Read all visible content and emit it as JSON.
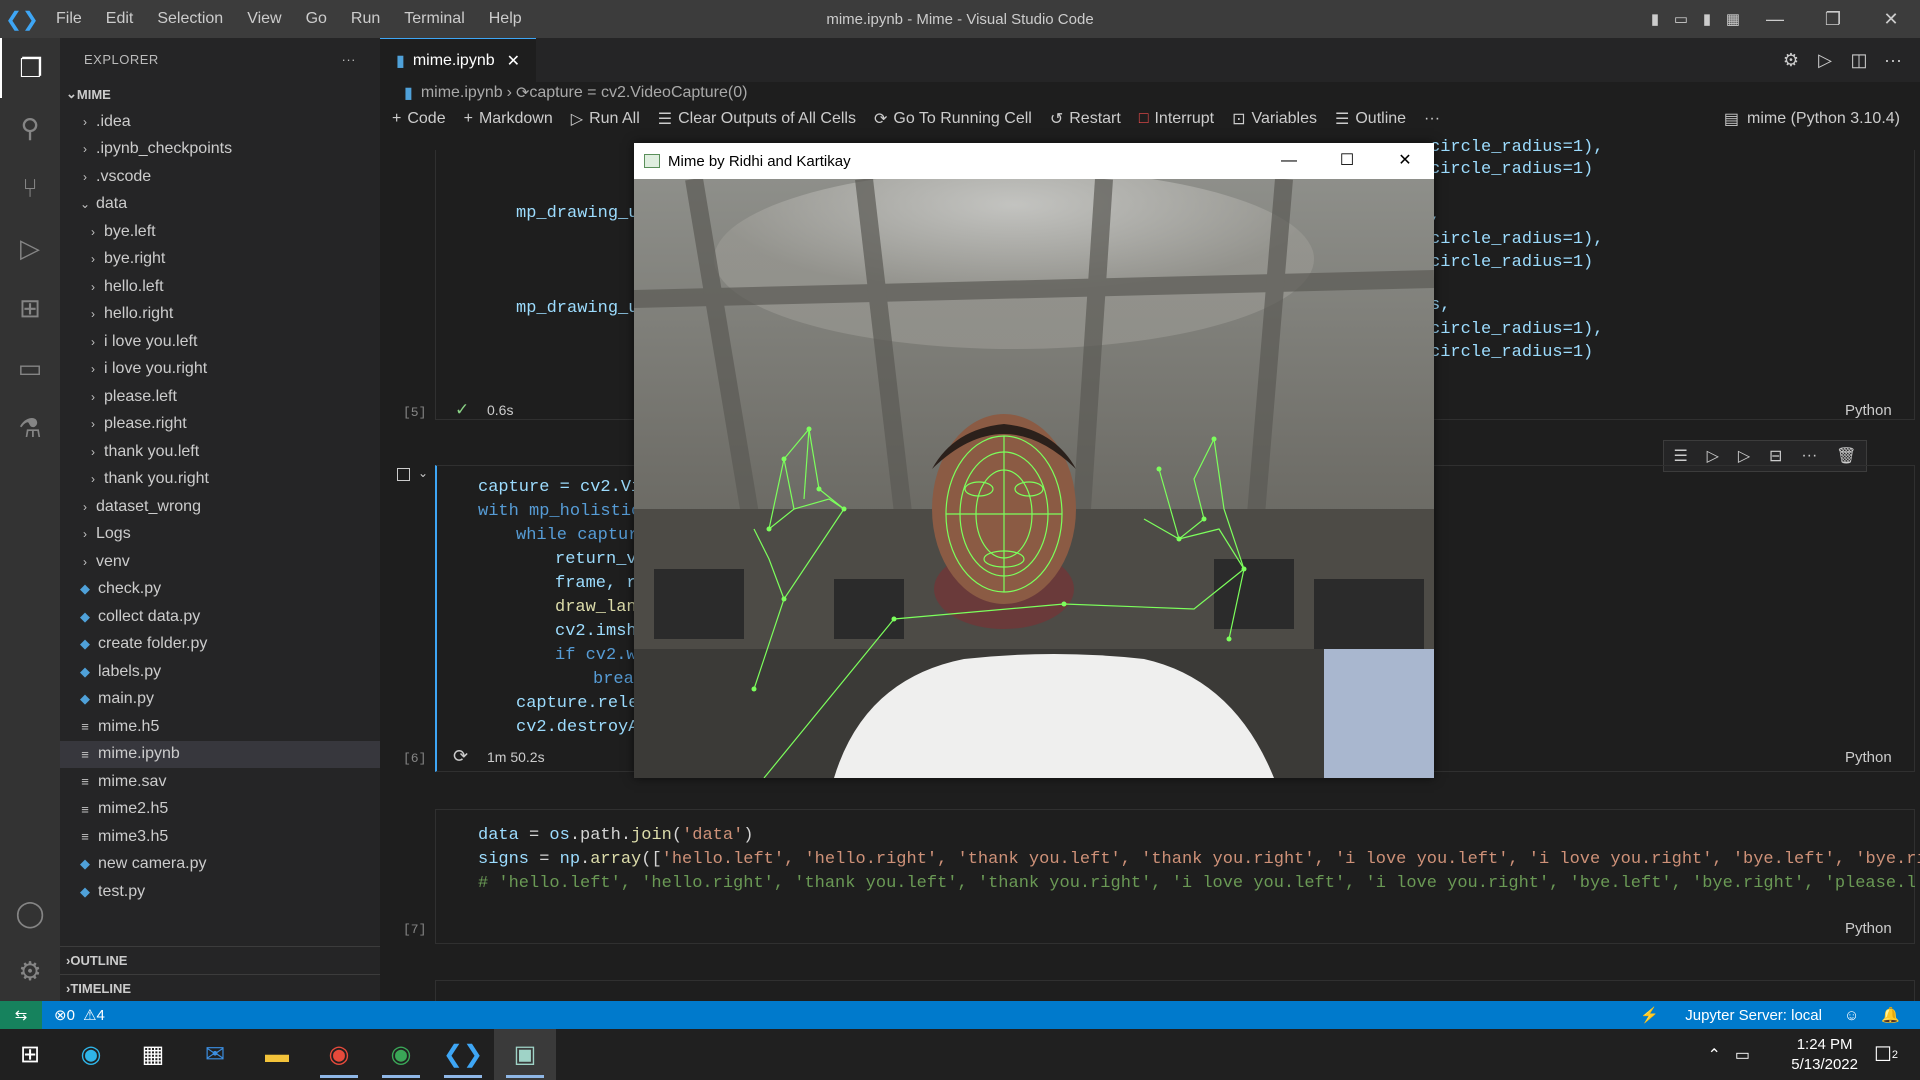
{
  "window": {
    "title": "mime.ipynb - Mime - Visual Studio Code",
    "menu": [
      "File",
      "Edit",
      "Selection",
      "View",
      "Go",
      "Run",
      "Terminal",
      "Help"
    ]
  },
  "explorer": {
    "header": "EXPLORER",
    "more": "···",
    "root": "MIME",
    "items": [
      {
        "label": ".idea",
        "kind": "folder",
        "indent": 1,
        "expanded": false
      },
      {
        "label": ".ipynb_checkpoints",
        "kind": "folder",
        "indent": 1,
        "expanded": false
      },
      {
        "label": ".vscode",
        "kind": "folder",
        "indent": 1,
        "expanded": false
      },
      {
        "label": "data",
        "kind": "folder",
        "indent": 1,
        "expanded": true
      },
      {
        "label": "bye.left",
        "kind": "folder",
        "indent": 2,
        "expanded": false
      },
      {
        "label": "bye.right",
        "kind": "folder",
        "indent": 2,
        "expanded": false
      },
      {
        "label": "hello.left",
        "kind": "folder",
        "indent": 2,
        "expanded": false
      },
      {
        "label": "hello.right",
        "kind": "folder",
        "indent": 2,
        "expanded": false
      },
      {
        "label": "i love you.left",
        "kind": "folder",
        "indent": 2,
        "expanded": false
      },
      {
        "label": "i love you.right",
        "kind": "folder",
        "indent": 2,
        "expanded": false
      },
      {
        "label": "please.left",
        "kind": "folder",
        "indent": 2,
        "expanded": false
      },
      {
        "label": "please.right",
        "kind": "folder",
        "indent": 2,
        "expanded": false
      },
      {
        "label": "thank you.left",
        "kind": "folder",
        "indent": 2,
        "expanded": false
      },
      {
        "label": "thank you.right",
        "kind": "folder",
        "indent": 2,
        "expanded": false
      },
      {
        "label": "dataset_wrong",
        "kind": "folder",
        "indent": 1,
        "expanded": false
      },
      {
        "label": "Logs",
        "kind": "folder",
        "indent": 1,
        "expanded": false
      },
      {
        "label": "venv",
        "kind": "folder",
        "indent": 1,
        "expanded": false
      },
      {
        "label": "check.py",
        "kind": "py",
        "indent": 1
      },
      {
        "label": "collect data.py",
        "kind": "py",
        "indent": 1
      },
      {
        "label": "create folder.py",
        "kind": "py",
        "indent": 1
      },
      {
        "label": "labels.py",
        "kind": "py",
        "indent": 1
      },
      {
        "label": "main.py",
        "kind": "py",
        "indent": 1
      },
      {
        "label": "mime.h5",
        "kind": "lines",
        "indent": 1
      },
      {
        "label": "mime.ipynb",
        "kind": "lines",
        "indent": 1,
        "selected": true
      },
      {
        "label": "mime.sav",
        "kind": "lines",
        "indent": 1
      },
      {
        "label": "mime2.h5",
        "kind": "lines",
        "indent": 1
      },
      {
        "label": "mime3.h5",
        "kind": "lines",
        "indent": 1
      },
      {
        "label": "new camera.py",
        "kind": "py",
        "indent": 1
      },
      {
        "label": "test.py",
        "kind": "py",
        "indent": 1
      }
    ],
    "outline": "OUTLINE",
    "timeline": "TIMELINE"
  },
  "editor": {
    "tab": "mime.ipynb",
    "breadcrumb_file": "mime.ipynb",
    "breadcrumb_symbol": "capture = cv2.VideoCapture(0)",
    "toolbar": {
      "code": "Code",
      "markdown": "Markdown",
      "run_all": "Run All",
      "clear": "Clear Outputs of All Cells",
      "goto": "Go To Running Cell",
      "restart": "Restart",
      "interrupt": "Interrupt",
      "variables": "Variables",
      "outline": "Outline",
      "more": "···",
      "kernel": "mime (Python 3.10.4)"
    },
    "cell5": {
      "exec": "[5]",
      "time": "0.6s",
      "lang": "Python",
      "left1": "mp_drawing_u",
      "left2": "mp_drawing_u",
      "right": [
        "circle_radius=1),",
        "circle_radius=1)",
        ",",
        "circle_radius=1),",
        "circle_radius=1)",
        "s,",
        "circle_radius=1),",
        "circle_radius=1)"
      ]
    },
    "cell6": {
      "exec": "[6]",
      "time": "1m 50.2s",
      "lang": "Python",
      "lines": [
        "capture = cv2.Vi",
        "with mp_holistic",
        "while captur",
        "return_v",
        "frame, r",
        "draw_lan",
        "cv2.imsh",
        "if cv2.w",
        "brea",
        "capture.rele",
        "cv2.destroyA"
      ]
    },
    "cell7": {
      "exec": "[7]",
      "lang": "Python",
      "line1_var": "data",
      "line1_rest_a": " = ",
      "line1_mod": "os",
      "line1_path": ".path.",
      "line1_fn": "join",
      "line1_arg": "'data'",
      "line2_var": "signs",
      "line2_mod": "np",
      "line2_fn": "array",
      "line2_items": "'hello.left', 'hello.right', 'thank you.left', 'thank you.right', 'i love you.left', 'i love you.right', 'bye.left', 'bye.right',",
      "line3": "# 'hello.left', 'hello.right', 'thank you.left', 'thank you.right', 'i love you.left', 'i love you.right', 'bye.left', 'bye.right', 'please.left', '"
    }
  },
  "popup": {
    "title": "Mime by Ridhi and Kartikay"
  },
  "status": {
    "errors": "0",
    "warnings": "4",
    "jupyter": "Jupyter Server: local"
  },
  "taskbar": {
    "time": "1:24 PM",
    "date": "5/13/2022",
    "notifications": "2"
  },
  "colors": {
    "accent": "#007acc",
    "landmark": "#7cff5c"
  }
}
